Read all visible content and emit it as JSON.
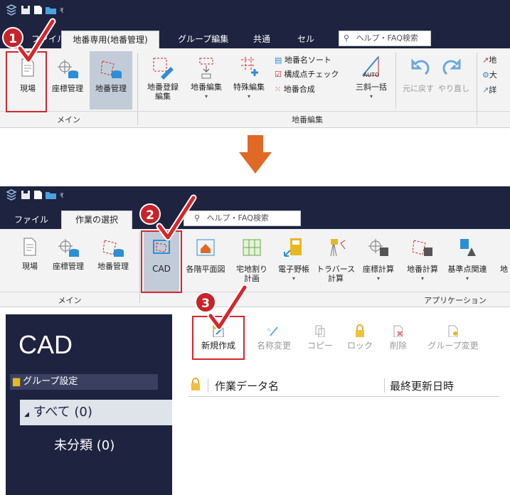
{
  "top": {
    "tabs": [
      "ファイル",
      "地番専用(地番管理)",
      "グループ編集",
      "共通",
      "セル"
    ],
    "search_placeholder": "ヘルプ・FAQ検索",
    "buttons": {
      "genba": "現場",
      "zahyo": "座標管理",
      "chiban": "地番管理",
      "chiban_toroku": "地番登録\n編集",
      "chiban_henshu": "地番編集",
      "tokushu": "特殊編集",
      "sort": "地番名ソート",
      "check": "構成点チェック",
      "gosei": "地番合成",
      "sankaku": "三斜一括",
      "auto": "AUTO",
      "undo": "元に戻す",
      "redo": "やり直し",
      "r1": "地",
      "r2": "大",
      "r3": "詳"
    },
    "groups": [
      "メイン",
      "地番編集"
    ]
  },
  "bottom": {
    "tabs": [
      "ファイル",
      "作業の選択"
    ],
    "search_placeholder": "ヘルプ・FAQ検索",
    "buttons": {
      "genba": "現場",
      "zahyo": "座標管理",
      "chiban": "地番管理",
      "cad": "CAD",
      "kakukai": "各階平面図",
      "takuchi": "宅地割り\n計画",
      "denshi": "電子野帳",
      "traverse": "トラバース\n計算",
      "zahyo_keisan": "座標計算",
      "chiban_keisan": "地番計算",
      "kijunten": "基準点関連",
      "more": "地"
    },
    "groups": [
      "メイン",
      "アプリケーション"
    ]
  },
  "cad_panel": {
    "title": "CAD",
    "group_settings": "グループ設定",
    "tree": [
      "すべて (0)",
      "未分類 (0)"
    ],
    "toolbar": [
      "新規作成",
      "名称変更",
      "コピー",
      "ロック",
      "削除",
      "グループ変更"
    ],
    "columns": [
      "作業データ名",
      "最終更新日時"
    ]
  },
  "steps": [
    "1",
    "2",
    "3"
  ],
  "colors": {
    "title": "#1e2340",
    "accent": "#d6262b",
    "arrow": "#e06a25",
    "selected": "#c2ccd9"
  }
}
